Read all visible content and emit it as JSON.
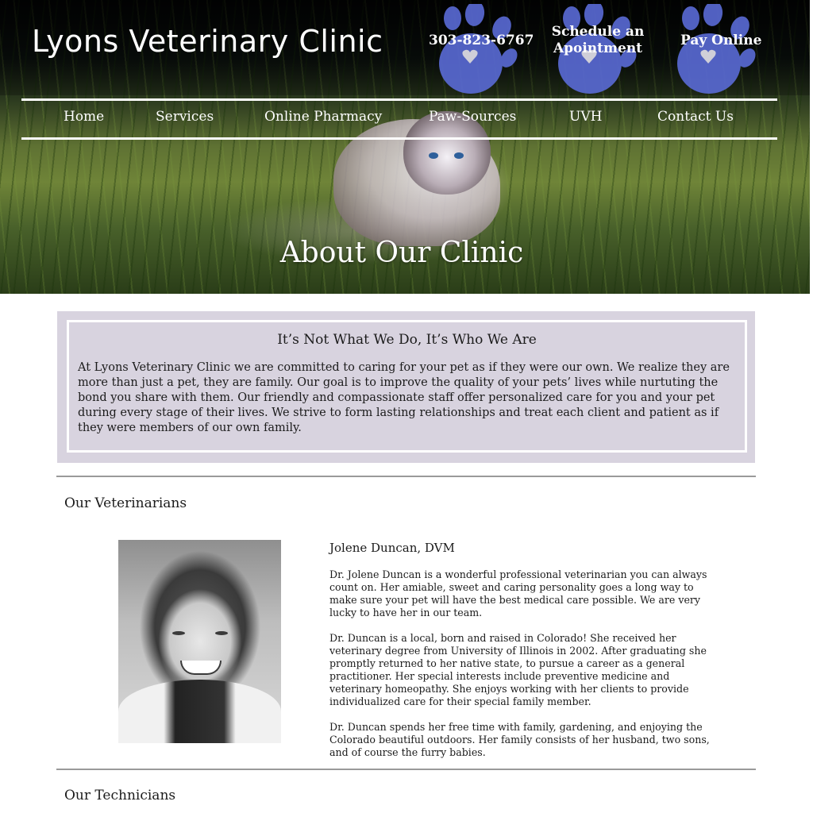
{
  "header": {
    "logo": "Lyons Veterinary Clinic",
    "phone": "303-823-6767",
    "schedule_line1": "Schedule an",
    "schedule_line2": "Apointment",
    "pay_online": "Pay Online"
  },
  "nav": {
    "items": [
      "Home",
      "Services",
      "Online Pharmacy",
      "Paw-Sources",
      "UVH",
      "Contact Us"
    ]
  },
  "hero": {
    "title": "About Our Clinic"
  },
  "intro": {
    "heading": "It’s Not What We Do, It’s Who We Are",
    "body": "At Lyons Veterinary Clinic we are committed to caring for your pet as if they were our own. We realize they are more than just a pet, they are family. Our goal is to improve the quality of your pets’ lives while nurtuting the bond you share with them. Our friendly and compassionate staff offer personalized care for you and your pet during every stage of their lives. We strive to form lasting relationships and treat each client and patient as if they were members of our own family."
  },
  "veterinarians": {
    "section_title": "Our Veterinarians",
    "vet": {
      "name": "Jolene Duncan, DVM",
      "paragraphs": [
        "Dr. Jolene Duncan is a wonderful professional veterinarian you can always count on. Her amiable, sweet and caring personality goes a long way to make sure your pet will have the best medical care possible. We are very lucky to have her in our team.",
        "Dr. Duncan is a local, born and raised in Colorado! She received her veterinary degree from University of Illinois in 2002. After graduating she promptly returned to her native state, to pursue a career as a general practitioner. Her special interests include preventive medicine and veterinary homeopathy. She enjoys working with her clients to provide individualized care for their special family member.",
        "Dr. Duncan spends her free time with family, gardening, and enjoying the Colorado beautiful outdoors. Her family consists of her husband, two sons, and of course the furry babies."
      ]
    }
  },
  "technicians": {
    "section_title": "Our Technicians"
  },
  "colors": {
    "paw": "#5a6bd6",
    "intro_bg": "#d8d3df",
    "divider": "#9a9a9a"
  },
  "icons": [
    "paw-icon",
    "heart-icon"
  ]
}
